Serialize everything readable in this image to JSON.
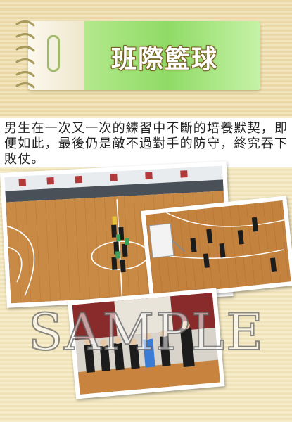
{
  "header": {
    "title": "班際籃球"
  },
  "description": "男生在一次又一次的練習中不斷的培養默契，即便如此，最後仍是敵不過對手的防守，終究吞下敗仗。",
  "watermark": "SAMPLE",
  "photos": [
    {
      "name": "court-lineup-photo"
    },
    {
      "name": "game-action-photo"
    },
    {
      "name": "team-huddle-photo"
    }
  ]
}
